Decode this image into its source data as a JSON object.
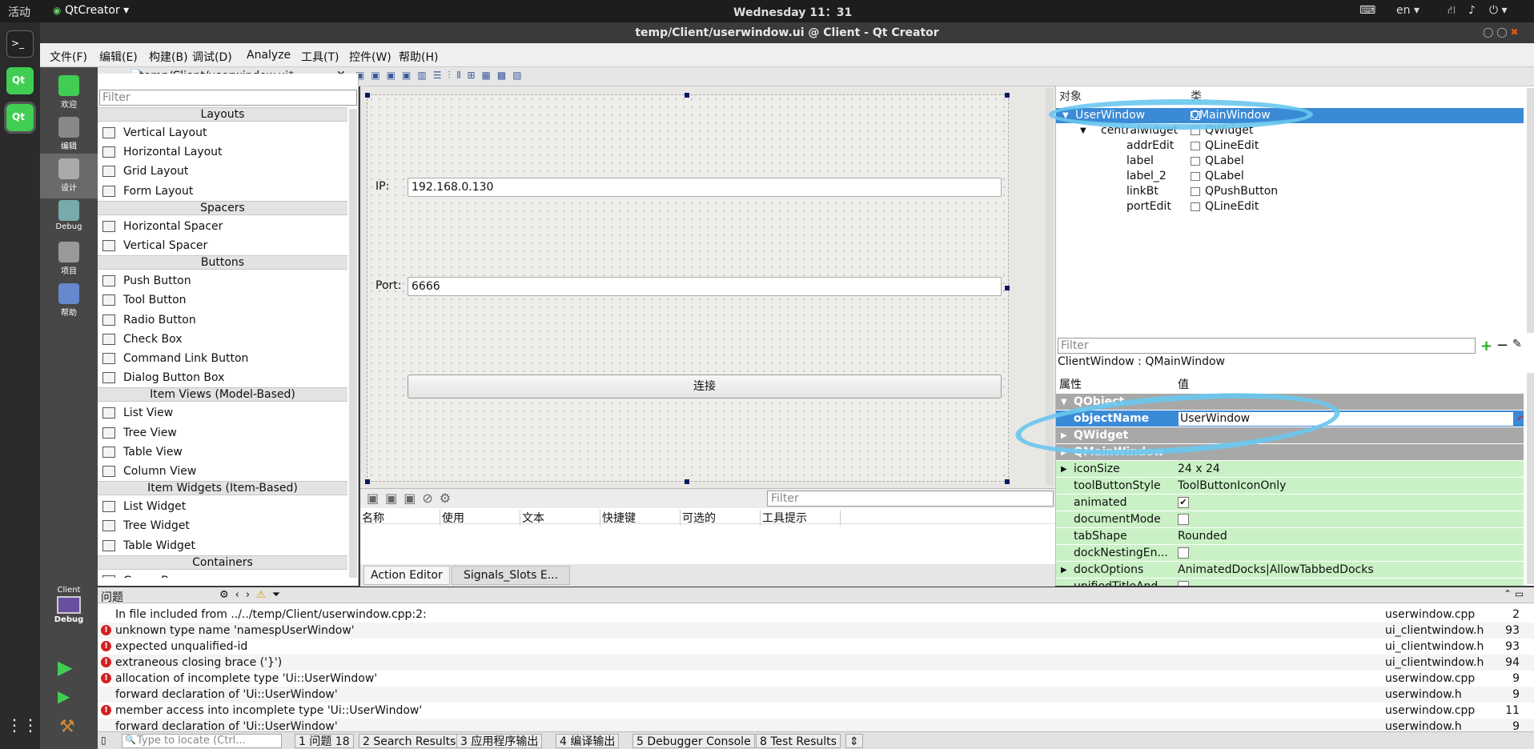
{
  "topbar": {
    "activities": "活动",
    "app": "QtCreator",
    "clock": "Wednesday 11：31",
    "lang": "en"
  },
  "window": {
    "title": "temp/Client/userwindow.ui @ Client - Qt Creator"
  },
  "menu": [
    "文件(F)",
    "编辑(E)",
    "构建(B)",
    "调试(D)",
    "Analyze",
    "工具(T)",
    "控件(W)",
    "帮助(H)"
  ],
  "modes": [
    "欢迎",
    "编辑",
    "设计",
    "Debug",
    "项目",
    "帮助"
  ],
  "run": {
    "kit": "Client",
    "mode": "Debug"
  },
  "document": {
    "name": "temp/Client/userwindow.ui*"
  },
  "widgetbox": {
    "filter": "Filter",
    "items": [
      {
        "cat": true,
        "label": "Layouts"
      },
      {
        "label": "Vertical Layout"
      },
      {
        "label": "Horizontal Layout"
      },
      {
        "label": "Grid Layout"
      },
      {
        "label": "Form Layout"
      },
      {
        "cat": true,
        "label": "Spacers"
      },
      {
        "label": "Horizontal Spacer"
      },
      {
        "label": "Vertical Spacer"
      },
      {
        "cat": true,
        "label": "Buttons"
      },
      {
        "label": "Push Button"
      },
      {
        "label": "Tool Button"
      },
      {
        "label": "Radio Button"
      },
      {
        "label": "Check Box"
      },
      {
        "label": "Command Link Button"
      },
      {
        "label": "Dialog Button Box"
      },
      {
        "cat": true,
        "label": "Item Views (Model-Based)"
      },
      {
        "label": "List View"
      },
      {
        "label": "Tree View"
      },
      {
        "label": "Table View"
      },
      {
        "label": "Column View"
      },
      {
        "cat": true,
        "label": "Item Widgets (Item-Based)"
      },
      {
        "label": "List Widget"
      },
      {
        "label": "Tree Widget"
      },
      {
        "label": "Table Widget"
      },
      {
        "cat": true,
        "label": "Containers"
      },
      {
        "label": "Group Box"
      }
    ]
  },
  "form": {
    "ip_label": "IP:",
    "ip_value": "192.168.0.130",
    "port_label": "Port:",
    "port_value": "6666",
    "button": "连接"
  },
  "actioneditor": {
    "filter": "Filter",
    "cols": [
      "名称",
      "使用",
      "文本",
      "快捷键",
      "可选的",
      "工具提示"
    ],
    "tabs": [
      "Action Editor",
      "Signals_Slots E..."
    ]
  },
  "objinspector": {
    "headers": [
      "对象",
      "类"
    ],
    "rows": [
      {
        "obj": "UserWindow",
        "cls": "QMainWindow",
        "indent": 0,
        "sel": true
      },
      {
        "obj": "centralwidget",
        "cls": "QWidget",
        "indent": 1
      },
      {
        "obj": "addrEdit",
        "cls": "QLineEdit",
        "indent": 2
      },
      {
        "obj": "label",
        "cls": "QLabel",
        "indent": 2
      },
      {
        "obj": "label_2",
        "cls": "QLabel",
        "indent": 2
      },
      {
        "obj": "linkBt",
        "cls": "QPushButton",
        "indent": 2
      },
      {
        "obj": "portEdit",
        "cls": "QLineEdit",
        "indent": 2
      }
    ]
  },
  "propeditor": {
    "filter": "Filter",
    "classline": "ClientWindow : QMainWindow",
    "headers": [
      "属性",
      "值"
    ],
    "rows": [
      {
        "k": "QObject",
        "v": "",
        "style": "grey"
      },
      {
        "k": "objectName",
        "v": "UserWindow",
        "style": "edit"
      },
      {
        "k": "QWidget",
        "v": "",
        "style": "grey"
      },
      {
        "k": "QMainWindow",
        "v": "",
        "style": "grey"
      },
      {
        "k": "iconSize",
        "v": "24 x 24",
        "style": "green"
      },
      {
        "k": "toolButtonStyle",
        "v": "ToolButtonIconOnly",
        "style": "green"
      },
      {
        "k": "animated",
        "v": "✔",
        "style": "green"
      },
      {
        "k": "documentMode",
        "v": "",
        "style": "green"
      },
      {
        "k": "tabShape",
        "v": "Rounded",
        "style": "green"
      },
      {
        "k": "dockNestingEn...",
        "v": "",
        "style": "green"
      },
      {
        "k": "dockOptions",
        "v": "AnimatedDocks|AllowTabbedDocks",
        "style": "green"
      },
      {
        "k": "unifiedTitleAnd...",
        "v": "",
        "style": "green"
      }
    ]
  },
  "issues": {
    "title": "问题",
    "rows": [
      {
        "err": false,
        "t": "In file included from ../../temp/Client/userwindow.cpp:2:",
        "f": "userwindow.cpp",
        "n": "2"
      },
      {
        "err": true,
        "t": "unknown type name 'namespUserWindow'",
        "f": "ui_clientwindow.h",
        "n": "93"
      },
      {
        "err": true,
        "t": "expected unqualified-id",
        "f": "ui_clientwindow.h",
        "n": "93"
      },
      {
        "err": true,
        "t": "extraneous closing brace ('}')",
        "f": "ui_clientwindow.h",
        "n": "94"
      },
      {
        "err": true,
        "t": "allocation of incomplete type 'Ui::UserWindow'",
        "f": "userwindow.cpp",
        "n": "9"
      },
      {
        "err": false,
        "t": "forward declaration of 'Ui::UserWindow'",
        "f": "userwindow.h",
        "n": "9"
      },
      {
        "err": true,
        "t": "member access into incomplete type 'Ui::UserWindow'",
        "f": "userwindow.cpp",
        "n": "11"
      },
      {
        "err": false,
        "t": "forward declaration of 'Ui::UserWindow'",
        "f": "userwindow.h",
        "n": "9"
      }
    ]
  },
  "bottom": {
    "locate": "Type to locate (Ctrl...",
    "tabs": [
      "1 问题 18",
      "2 Search Results",
      "3 应用程序输出",
      "4 编译输出",
      "5 Debugger Console",
      "8 Test Results"
    ]
  },
  "colors": {
    "accent": "#3a8ad6",
    "propGreen": "#c9f1c5",
    "annotation": "#69c7ee"
  }
}
